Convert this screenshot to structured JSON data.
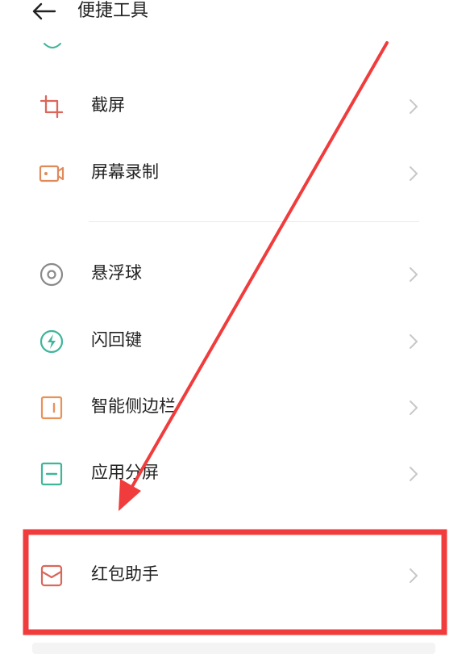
{
  "header": {
    "title": "便捷工具",
    "back_icon": "arrow-left-icon"
  },
  "items": [
    {
      "id": "screenshot",
      "label": "截屏",
      "icon": "crop-icon",
      "icon_color": "#d9675a"
    },
    {
      "id": "screen-record",
      "label": "屏幕录制",
      "icon": "video-icon",
      "icon_color": "#e08a5a"
    },
    {
      "id": "floating-ball",
      "label": "悬浮球",
      "icon": "circle-dot-icon",
      "icon_color": "#8a8a8a"
    },
    {
      "id": "flash-key",
      "label": "闪回键",
      "icon": "lightning-icon",
      "icon_color": "#3fb59a"
    },
    {
      "id": "smart-sidebar",
      "label": "智能侧边栏",
      "icon": "sidebar-icon",
      "icon_color": "#e8925a"
    },
    {
      "id": "split-screen",
      "label": "应用分屏",
      "icon": "split-screen-icon",
      "icon_color": "#3fb59a"
    },
    {
      "id": "red-packet",
      "label": "红包助手",
      "icon": "envelope-icon",
      "icon_color": "#d9675a"
    }
  ],
  "annotation": {
    "highlight_color": "#f03c3c",
    "arrow_color": "#f03c3c"
  }
}
